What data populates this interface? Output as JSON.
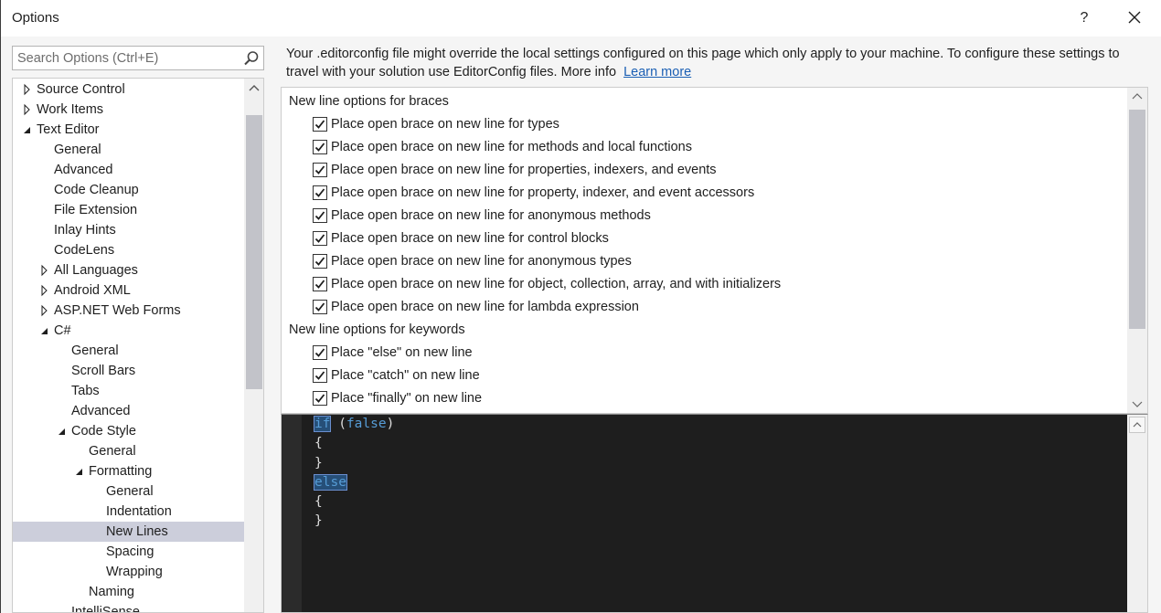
{
  "window": {
    "title": "Options",
    "help_label": "?"
  },
  "search": {
    "placeholder": "Search Options (Ctrl+E)"
  },
  "tree": [
    {
      "label": "Source Control",
      "level": 0,
      "arrow": "collapsed"
    },
    {
      "label": "Work Items",
      "level": 0,
      "arrow": "collapsed"
    },
    {
      "label": "Text Editor",
      "level": 0,
      "arrow": "expanded"
    },
    {
      "label": "General",
      "level": 1,
      "arrow": "none"
    },
    {
      "label": "Advanced",
      "level": 1,
      "arrow": "none"
    },
    {
      "label": "Code Cleanup",
      "level": 1,
      "arrow": "none"
    },
    {
      "label": "File Extension",
      "level": 1,
      "arrow": "none"
    },
    {
      "label": "Inlay Hints",
      "level": 1,
      "arrow": "none"
    },
    {
      "label": "CodeLens",
      "level": 1,
      "arrow": "none"
    },
    {
      "label": "All Languages",
      "level": 1,
      "arrow": "collapsed"
    },
    {
      "label": "Android XML",
      "level": 1,
      "arrow": "collapsed"
    },
    {
      "label": "ASP.NET Web Forms",
      "level": 1,
      "arrow": "collapsed"
    },
    {
      "label": "C#",
      "level": 1,
      "arrow": "expanded"
    },
    {
      "label": "General",
      "level": 2,
      "arrow": "none"
    },
    {
      "label": "Scroll Bars",
      "level": 2,
      "arrow": "none"
    },
    {
      "label": "Tabs",
      "level": 2,
      "arrow": "none"
    },
    {
      "label": "Advanced",
      "level": 2,
      "arrow": "none"
    },
    {
      "label": "Code Style",
      "level": 2,
      "arrow": "expanded"
    },
    {
      "label": "General",
      "level": 3,
      "arrow": "none"
    },
    {
      "label": "Formatting",
      "level": 3,
      "arrow": "expanded"
    },
    {
      "label": "General",
      "level": 4,
      "arrow": "none"
    },
    {
      "label": "Indentation",
      "level": 4,
      "arrow": "none"
    },
    {
      "label": "New Lines",
      "level": 4,
      "arrow": "none",
      "selected": true
    },
    {
      "label": "Spacing",
      "level": 4,
      "arrow": "none"
    },
    {
      "label": "Wrapping",
      "level": 4,
      "arrow": "none"
    },
    {
      "label": "Naming",
      "level": 3,
      "arrow": "none"
    },
    {
      "label": "IntelliSense",
      "level": 2,
      "arrow": "none"
    }
  ],
  "info": {
    "text": "Your .editorconfig file might override the local settings configured on this page which only apply to your machine. To configure these settings to travel with your solution use EditorConfig files. More info",
    "link": "Learn more"
  },
  "options": {
    "groups": [
      {
        "heading": "New line options for braces",
        "items": [
          {
            "label": "Place open brace on new line for types",
            "checked": true
          },
          {
            "label": "Place open brace on new line for methods and local functions",
            "checked": true
          },
          {
            "label": "Place open brace on new line for properties, indexers, and events",
            "checked": true
          },
          {
            "label": "Place open brace on new line for property, indexer, and event accessors",
            "checked": true
          },
          {
            "label": "Place open brace on new line for anonymous methods",
            "checked": true
          },
          {
            "label": "Place open brace on new line for control blocks",
            "checked": true
          },
          {
            "label": "Place open brace on new line for anonymous types",
            "checked": true
          },
          {
            "label": "Place open brace on new line for object, collection, array, and with initializers",
            "checked": true
          },
          {
            "label": "Place open brace on new line for lambda expression",
            "checked": true
          }
        ]
      },
      {
        "heading": "New line options for keywords",
        "items": [
          {
            "label": "Place \"else\" on new line",
            "checked": true
          },
          {
            "label": "Place \"catch\" on new line",
            "checked": true
          },
          {
            "label": "Place \"finally\" on new line",
            "checked": true
          }
        ]
      }
    ]
  },
  "preview": {
    "lines": [
      [
        {
          "t": "if",
          "cls": "kw hl"
        },
        {
          "t": " (",
          "cls": ""
        },
        {
          "t": "false",
          "cls": "kw"
        },
        {
          "t": ")",
          "cls": ""
        }
      ],
      [
        {
          "t": "{",
          "cls": ""
        }
      ],
      [
        {
          "t": "}",
          "cls": ""
        }
      ],
      [
        {
          "t": "else",
          "cls": "kw hl"
        }
      ],
      [
        {
          "t": "{",
          "cls": ""
        }
      ],
      [
        {
          "t": "}",
          "cls": ""
        }
      ]
    ]
  },
  "colors": {
    "selection": "#cccedb",
    "keyword": "#569cd6",
    "link": "#1a5fb4",
    "editor_bg": "#1e1e1e"
  }
}
